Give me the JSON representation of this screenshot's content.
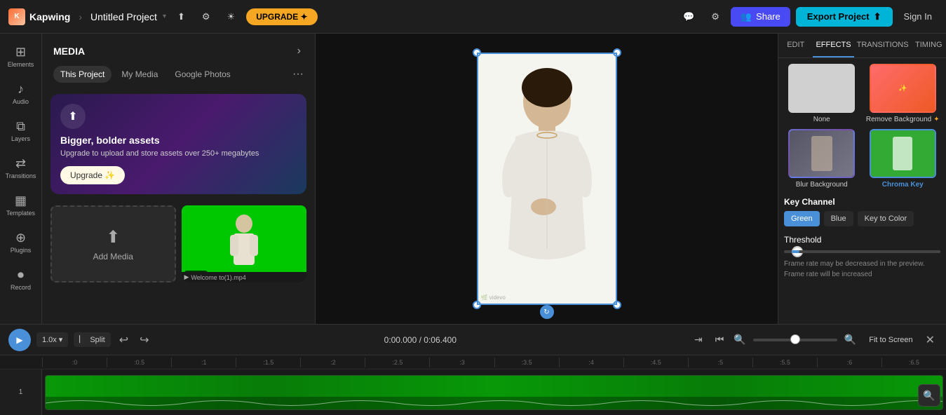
{
  "topbar": {
    "logo_text": "Kapwing",
    "project_name": "Untitled Project",
    "upgrade_label": "UPGRADE ✦",
    "share_label": "Share",
    "export_label": "Export Project",
    "signin_label": "Sign In"
  },
  "left_sidebar": {
    "items": [
      {
        "id": "elements",
        "icon": "⊞",
        "label": "Elements"
      },
      {
        "id": "audio",
        "icon": "♪",
        "label": "Audio"
      },
      {
        "id": "layers",
        "icon": "⧉",
        "label": "Layers"
      },
      {
        "id": "transitions",
        "icon": "⇄",
        "label": "Transitions"
      },
      {
        "id": "templates",
        "icon": "▦",
        "label": "Templates"
      },
      {
        "id": "plugins",
        "icon": "⊕",
        "label": "Plugins"
      },
      {
        "id": "record",
        "icon": "⏺",
        "label": "Record"
      }
    ]
  },
  "media_panel": {
    "title": "MEDIA",
    "tabs": [
      {
        "id": "this-project",
        "label": "This Project",
        "active": true
      },
      {
        "id": "my-media",
        "label": "My Media",
        "active": false
      },
      {
        "id": "google-photos",
        "label": "Google Photos",
        "active": false
      }
    ],
    "upgrade_card": {
      "title": "Bigger, bolder assets",
      "description": "Upgrade to upload and store assets over 250+ megabytes",
      "button_label": "Upgrade ✨"
    },
    "add_media_label": "Add Media",
    "media_items": [
      {
        "id": "video1",
        "duration": "00:06",
        "filename": "Welcome to(1).mp4"
      }
    ]
  },
  "canvas": {
    "time_position": "rotate"
  },
  "right_panel": {
    "tabs": [
      {
        "id": "edit",
        "label": "EDIT"
      },
      {
        "id": "effects",
        "label": "EFFECTS",
        "active": true
      },
      {
        "id": "transitions",
        "label": "TRANSITIONS"
      },
      {
        "id": "timing",
        "label": "TIMING"
      }
    ],
    "effects": {
      "none_label": "None",
      "remove_bg_label": "Remove Background",
      "blur_bg_label": "Blur Background",
      "chroma_key_label": "Chroma Key",
      "key_channel_label": "Key Channel",
      "key_buttons": [
        {
          "id": "green",
          "label": "Green",
          "active": true
        },
        {
          "id": "blue",
          "label": "Blue",
          "active": false
        },
        {
          "id": "key-to-color",
          "label": "Key to Color",
          "active": false
        }
      ],
      "threshold_label": "Threshold",
      "info_text": "Frame rate may be decreased in the preview. Frame rate will be increased"
    }
  },
  "timeline": {
    "play_label": "▶",
    "speed_label": "1.0x",
    "split_label": "⎸ Split",
    "time_display": "0:00.000 / 0:06.400",
    "fit_screen_label": "Fit to Screen",
    "ruler_marks": [
      ":0",
      ":0.5",
      ":1",
      ":1.5",
      ":2",
      ":2.5",
      ":3",
      ":3.5",
      ":4",
      ":4.5",
      ":5",
      ":5.5",
      ":6",
      ":6.5"
    ],
    "track_label": "1"
  }
}
